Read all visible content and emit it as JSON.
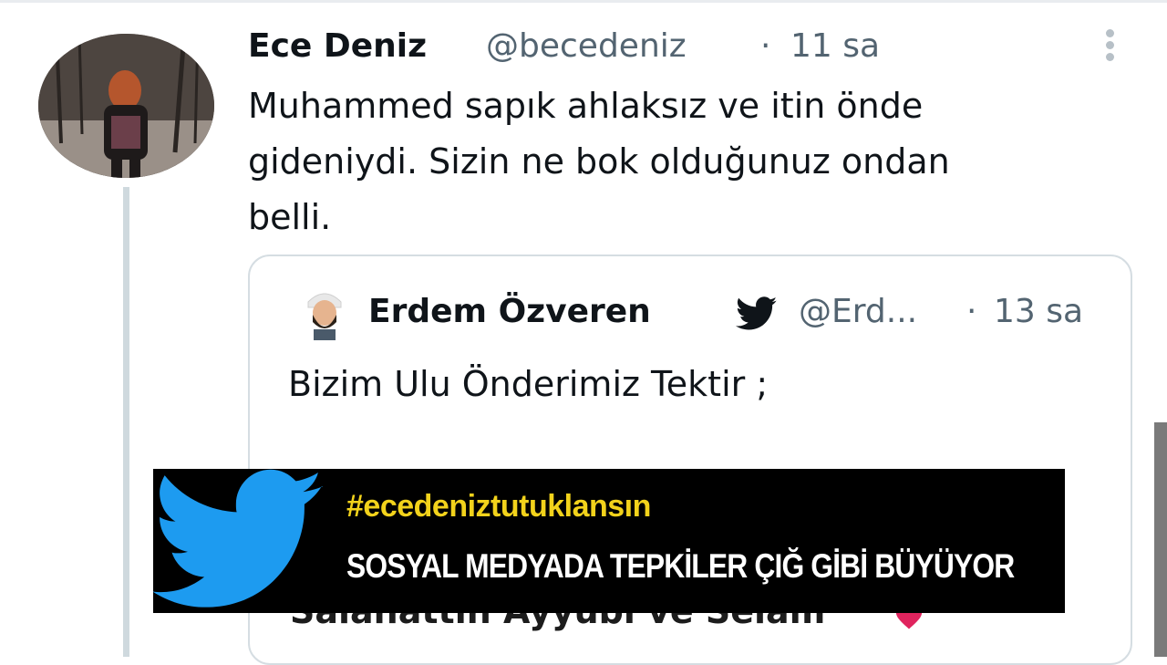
{
  "tweet": {
    "author_name": "Ece Deniz",
    "author_handle": "@becedeniz",
    "separator": "·",
    "time": "11 sa",
    "text": "Muhammed sapık ahlaksız ve itin önde\ngideniydi. Sizin ne bok olduğunuz ondan\nbelli."
  },
  "quoted_tweet": {
    "author_name": "Erdem Özveren",
    "author_handle": "@Erd...",
    "separator": "·",
    "time": "13 sa",
    "text": "Bizim Ulu Önderimiz Tektir ;",
    "partial_line": "Salahattin Ayyubi ve Selam"
  },
  "banner": {
    "hashtag": "#ecedeniztutuklansın",
    "headline": "SOSYAL MEDYADA TEPKİLER ÇIĞ GİBİ BÜYÜYOR"
  },
  "icons": [
    "more-icon",
    "twitter-bird-icon",
    "heart-icon"
  ],
  "colors": {
    "twitter_blue": "#1d9bf0",
    "banner_yellow": "#f2d21b",
    "banner_bg": "#000000",
    "muted_text": "#536471"
  }
}
